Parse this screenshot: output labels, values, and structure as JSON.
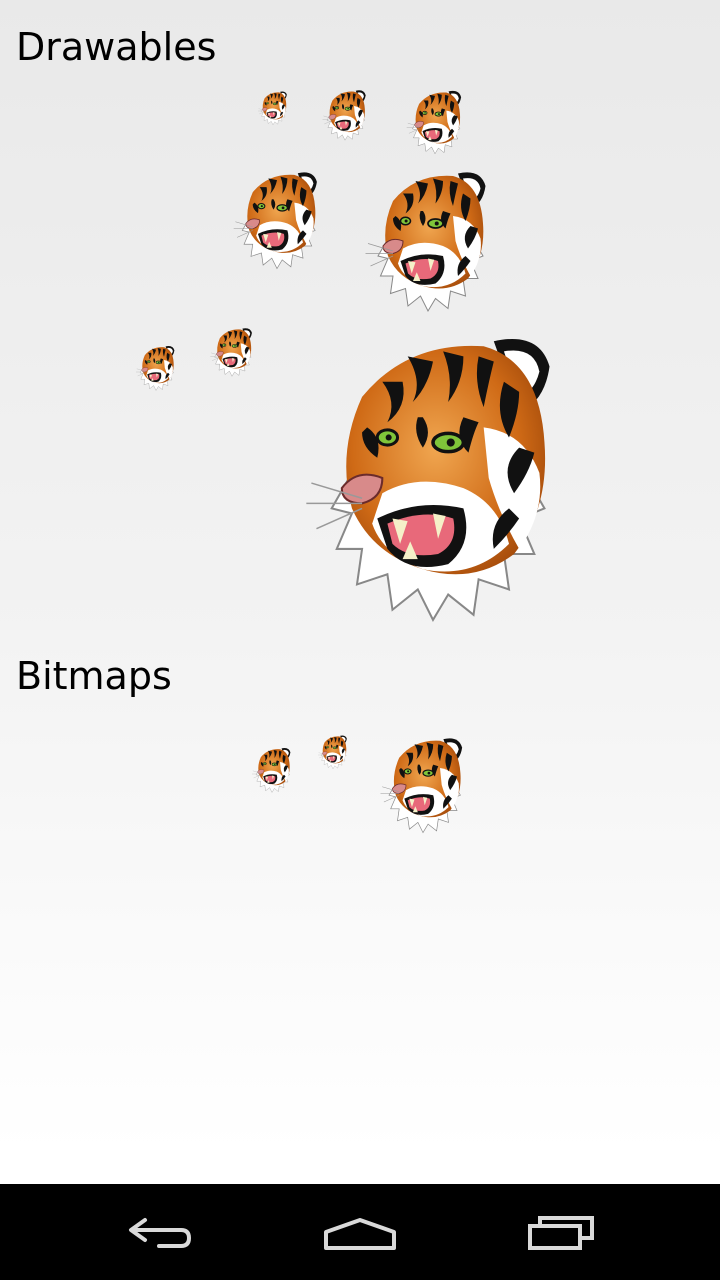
{
  "sections": {
    "drawables": {
      "title": "Drawables"
    },
    "bitmaps": {
      "title": "Bitmaps"
    }
  },
  "colors": {
    "background_top": "#e9e9e9",
    "background_bottom": "#ffffff",
    "tiger_orange": "#cf6a16",
    "tiger_stripe": "#111111",
    "tiger_mouth": "#e8697a",
    "tiger_eye": "#7fc53a",
    "navbar": "#000000",
    "nav_icon": "#d9d9d9"
  },
  "images": {
    "icon": "tiger-head-image"
  },
  "navbar": {
    "back_icon": "back-arrow-icon",
    "home_icon": "home-icon",
    "recents_icon": "recent-apps-icon"
  }
}
